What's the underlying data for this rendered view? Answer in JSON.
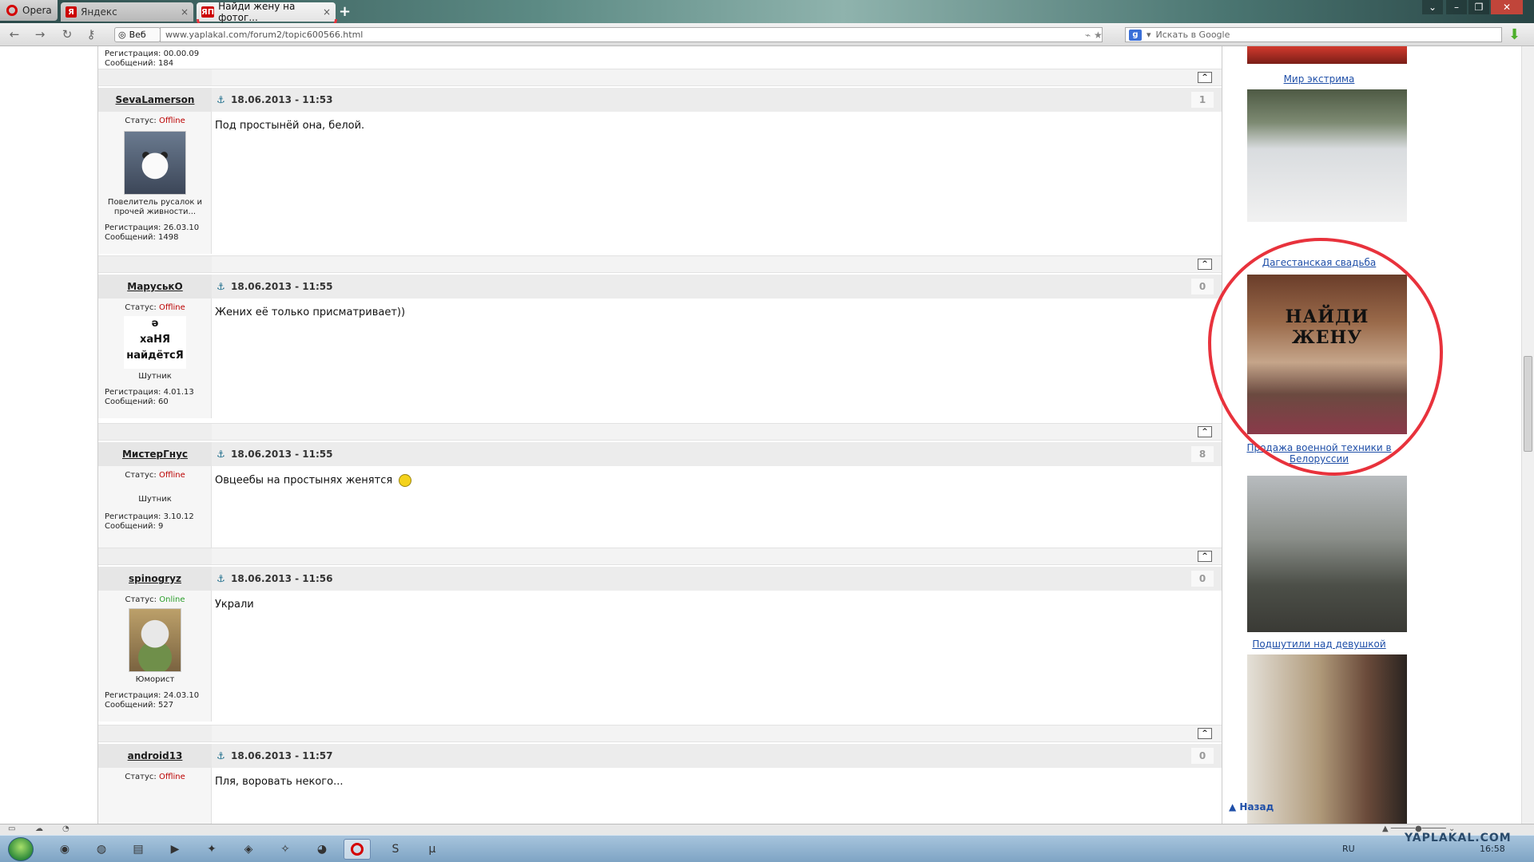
{
  "browser": {
    "opera_label": "Opera",
    "tabs": [
      {
        "label": "Яндекс",
        "fav": "Я",
        "active": false
      },
      {
        "label": "Найди жену на фотог...",
        "fav": "ЯП",
        "active": true
      }
    ],
    "web_badge": "Веб",
    "url": "www.yaplakal.com/forum2/topic600566.html",
    "search_placeholder": "Искать в Google"
  },
  "prev_post_stats": {
    "reg": "Регистрация: 00.00.09",
    "msgs": "Сообщений: 184"
  },
  "posts": [
    {
      "author": "SevaLamerson",
      "date": "18.06.2013 - 11:53",
      "rating": "1",
      "status_label": "Статус:",
      "status": "Offline",
      "title_line": "Повелитель русалок и прочей живности...",
      "reg": "Регистрация: 26.03.10",
      "msgs": "Сообщений: 1498",
      "text": "Под простынёй она, белой."
    },
    {
      "author": "МаруськО",
      "date": "18.06.2013 - 11:55",
      "rating": "0",
      "status_label": "Статус:",
      "status": "Offline",
      "avatar_text_1": "ə",
      "avatar_text_2": "хаНЯ",
      "avatar_text_3": "найдётсЯ",
      "title_line": "Шутник",
      "reg": "Регистрация: 4.01.13",
      "msgs": "Сообщений: 60",
      "text": "Жених её только присматривает))"
    },
    {
      "author": "МистерГнус",
      "date": "18.06.2013 - 11:55",
      "rating": "8",
      "status_label": "Статус:",
      "status": "Offline",
      "title_line": "Шутник",
      "reg": "Регистрация: 3.10.12",
      "msgs": "Сообщений: 9",
      "text": "Овцеебы на простынях женятся"
    },
    {
      "author": "spinogryz",
      "date": "18.06.2013 - 11:56",
      "rating": "0",
      "status_label": "Статус:",
      "status": "Online",
      "title_line": "Юморист",
      "reg": "Регистрация: 24.03.10",
      "msgs": "Сообщений: 527",
      "text": "Украли"
    },
    {
      "author": "android13",
      "date": "18.06.2013 - 11:57",
      "rating": "0",
      "status_label": "Статус:",
      "status": "Offline",
      "text": "Пля, воровать некого..."
    }
  ],
  "sidebar": {
    "links": [
      "Мир экстрима",
      "Дагестанская свадьба",
      "Продажа военной техники в Белоруссии",
      "Подшутили над девушкой"
    ],
    "wedding_image_caption": "НАЙДИ ЖЕНУ",
    "back_label": "Назад"
  },
  "up_label": "^",
  "taskbar": {
    "lang": "RU",
    "time": "16:58"
  },
  "watermark": "YAPLAKAL.COM",
  "colors": {
    "offline": "#bb0000",
    "online": "#2a9d2a",
    "link": "#1f4fa8",
    "annotation": "#e8323c"
  }
}
